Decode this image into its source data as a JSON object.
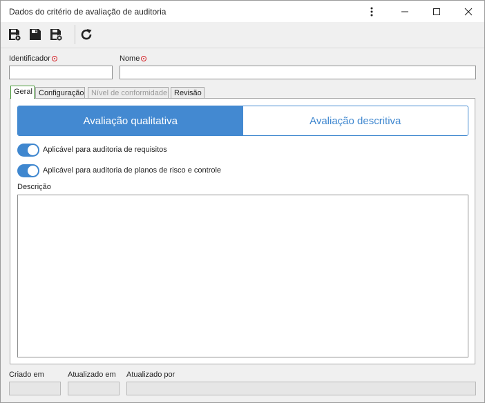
{
  "window": {
    "title": "Dados do critério de avaliação de auditoria"
  },
  "form": {
    "identificador_label": "Identificador",
    "nome_label": "Nome",
    "identificador_value": "",
    "nome_value": ""
  },
  "tabs": [
    {
      "label": "Geral",
      "state": "active"
    },
    {
      "label": "Configuração",
      "state": "normal"
    },
    {
      "label": "Nível de conformidade",
      "state": "disabled"
    },
    {
      "label": "Revisão",
      "state": "normal"
    }
  ],
  "segment": {
    "options": [
      "Avaliação qualitativa",
      "Avaliação descritiva"
    ],
    "selected": "Avaliação qualitativa"
  },
  "toggles": [
    {
      "label": "Aplicável para auditoria de requisitos",
      "on": true
    },
    {
      "label": "Aplicável para auditoria de planos de risco e controle",
      "on": true
    }
  ],
  "descricao": {
    "label": "Descrição",
    "value": ""
  },
  "footer": {
    "criado_em_label": "Criado em",
    "atualizado_em_label": "Atualizado em",
    "atualizado_por_label": "Atualizado por"
  },
  "colors": {
    "accent": "#4389d1",
    "required": "#d6262c",
    "active_tab_border": "#4a9a3a"
  }
}
